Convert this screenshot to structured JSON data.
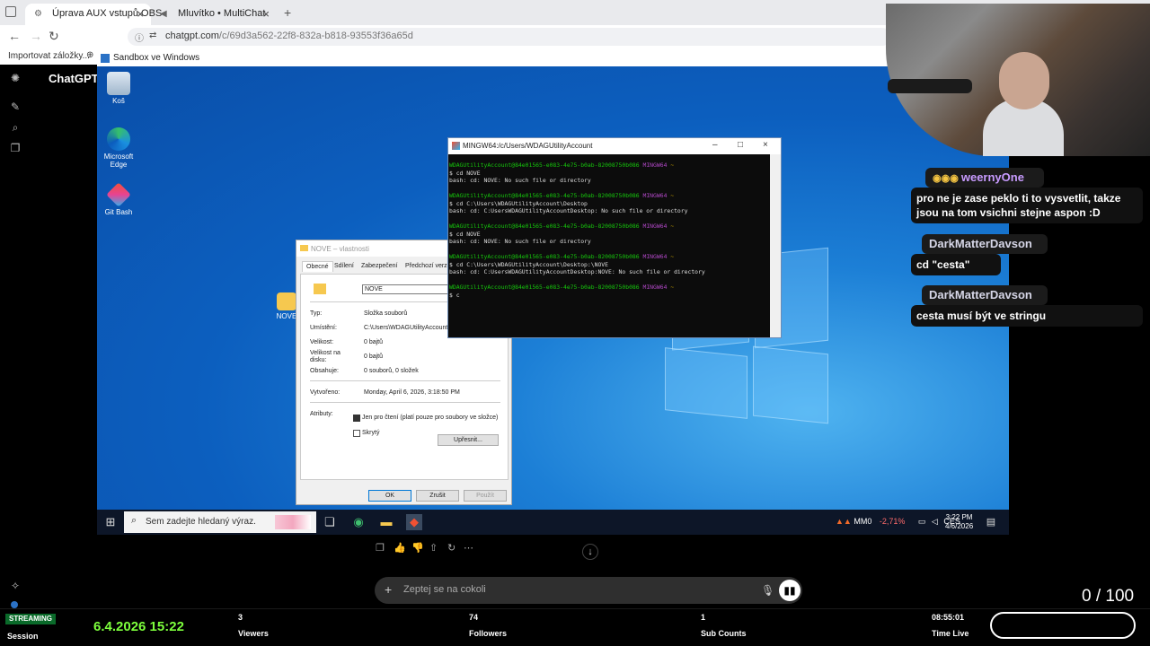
{
  "browser": {
    "tabs": [
      {
        "label": "Úprava AUX vstupů OBS",
        "active": true
      },
      {
        "label": "Mluvítko • MultiChat",
        "active": false
      }
    ],
    "url_host": "chatgpt.com",
    "url_path": "/c/69d3a562-22f8-832a-b818-93553f36a65d",
    "bookmarks_label": "Importovat záložky..."
  },
  "gpt": {
    "brand": "ChatGPT",
    "prompt_placeholder": "Zeptej se na cokoli"
  },
  "sandbox": {
    "title": "Sandbox ve Windows",
    "desktop_icons": [
      {
        "label": "Koš",
        "icon": "recycle-bin-icon"
      },
      {
        "label": "Microsoft Edge",
        "icon": "edge-icon"
      },
      {
        "label": "Git Bash",
        "icon": "git-bash-icon"
      }
    ],
    "folder_label": "NOVE"
  },
  "properties": {
    "title": "NOVE – vlastnosti",
    "tabs": [
      "Obecné",
      "Sdílení",
      "Zabezpečení",
      "Předchozí verze"
    ],
    "name": "NOVE",
    "rows": [
      {
        "label": "Typ:",
        "value": "Složka souborů"
      },
      {
        "label": "Umístění:",
        "value": "C:\\Users\\WDAGUtilityAccount\\D"
      },
      {
        "label": "Velikost:",
        "value": "0 bajtů"
      },
      {
        "label": "Velikost na disku:",
        "value": "0 bajtů"
      },
      {
        "label": "Obsahuje:",
        "value": "0 souborů, 0 složek"
      },
      {
        "label": "Vytvořeno:",
        "value": "Monday, April 6, 2026, 3:18:50 PM"
      }
    ],
    "attributes_label": "Atributy:",
    "readonly_label": "Jen pro čtení (platí pouze pro soubory ve složce)",
    "hidden_label": "Skrytý",
    "advanced_button": "Upřesnit...",
    "ok_button": "OK",
    "cancel_button": "Zrušit",
    "apply_button": "Použít"
  },
  "terminal": {
    "title": "MINGW64:/c/Users/WDAGUtilityAccount",
    "prompt_user": "WDAGUtilityAccount@84e01565-e083-4e75-b0ab-82008750b086",
    "prompt_env": "MINGW64",
    "prompt_dir": "~",
    "blocks": [
      {
        "cmd": "$ cd NOVE",
        "out": "bash: cd: NOVE: No such file or directory"
      },
      {
        "cmd": "$ cd C:\\Users\\WDAGUtilityAccount\\Desktop",
        "out": "bash: cd: C:UsersWDAGUtilityAccountDesktop: No such file or directory"
      },
      {
        "cmd": "$ cd NOVE",
        "out": "bash: cd: NOVE: No such file or directory"
      },
      {
        "cmd": "$ cd C:\\Users\\WDAGUtilityAccount\\Desktop:\\NOVE",
        "out": "bash: cd: C:UsersWDAGUtilityAccountDesktop:NOVE: No such file or directory"
      }
    ],
    "current_input": "$ c"
  },
  "taskbar": {
    "search_placeholder": "Sem zadejte hledaný výraz.",
    "ticker": "MM0",
    "ticker_change": "-2,71%",
    "language": "CES",
    "time": "3:22 PM",
    "date": "4/6/2026"
  },
  "chat": {
    "messages": [
      {
        "user": "weernyOne",
        "text": "pro ne je zase peklo ti to vysvetlit, takze jsou na tom vsichni stejne aspon :D"
      },
      {
        "user": "DarkMatterDavson",
        "text": "cd \"cesta\""
      },
      {
        "user": "DarkMatterDavson",
        "text": "cesta musí být ve stringu"
      }
    ],
    "colors": {
      "weernyOne": "#c89bff",
      "DarkMatterDavson": "#d7d7e8"
    }
  },
  "stream": {
    "status_badge": "STREAMING",
    "session_label": "Session",
    "date_time": "6.4.2026 15:22",
    "viewers": "3",
    "viewers_label": "Viewers",
    "followers": "74",
    "followers_label": "Followers",
    "subs": "1",
    "subs_label": "Sub Counts",
    "time_live": "08:55:01",
    "time_live_label": "Time Live",
    "goal": "0 / 100"
  }
}
